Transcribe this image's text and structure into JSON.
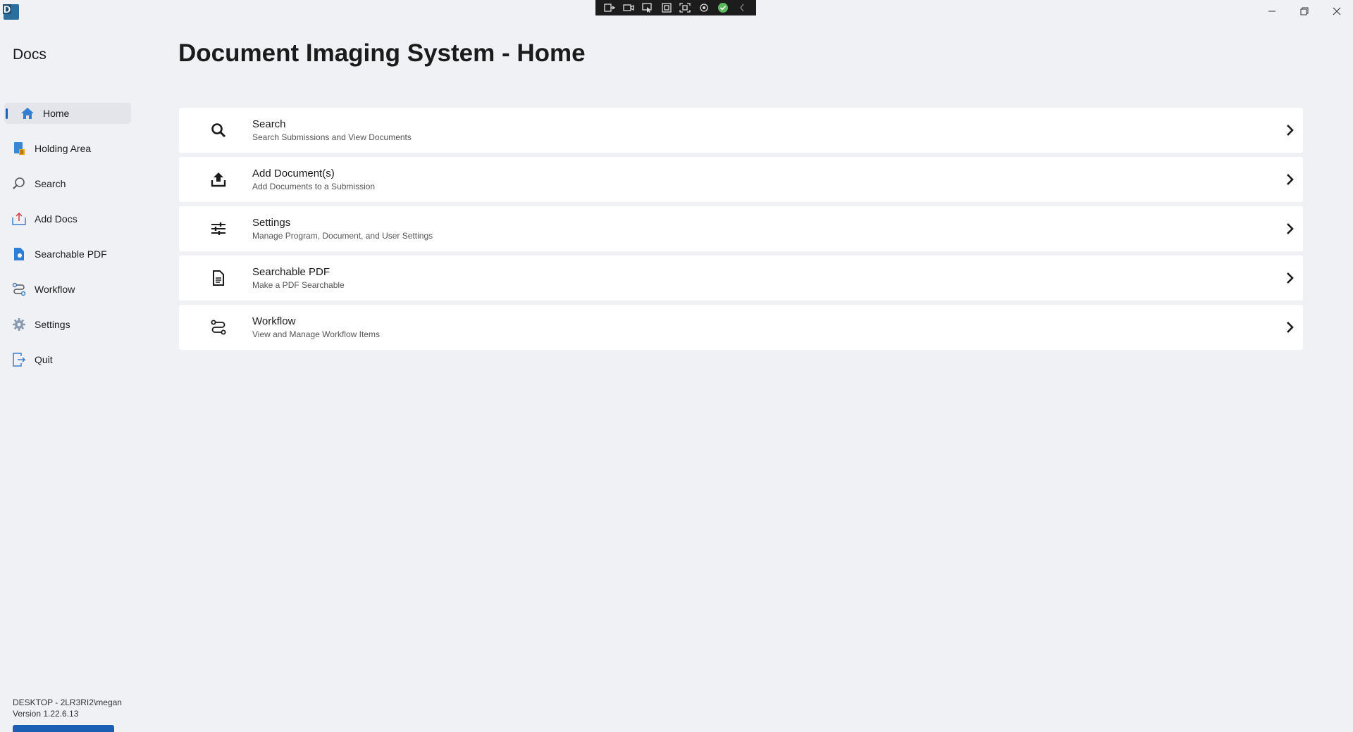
{
  "app": {
    "logo_letter": "D",
    "name": "Docs"
  },
  "titlebar": {
    "recorder_icons": [
      "steps-recorder-icon",
      "video-icon",
      "pointer-icon",
      "region-icon",
      "capture-icon",
      "settings-icon",
      "check-icon",
      "collapse-icon"
    ]
  },
  "window_controls": {
    "minimize": "─",
    "restore": "❐",
    "close": "✕"
  },
  "sidebar": {
    "items": [
      {
        "label": "Home",
        "icon": "home-icon",
        "active": true
      },
      {
        "label": "Holding Area",
        "icon": "holding-area-icon",
        "active": false
      },
      {
        "label": "Search",
        "icon": "search-icon",
        "active": false
      },
      {
        "label": "Add Docs",
        "icon": "add-docs-icon",
        "active": false
      },
      {
        "label": "Searchable PDF",
        "icon": "pdf-icon",
        "active": false
      },
      {
        "label": "Workflow",
        "icon": "workflow-icon",
        "active": false
      },
      {
        "label": "Settings",
        "icon": "gear-icon",
        "active": false
      },
      {
        "label": "Quit",
        "icon": "quit-icon",
        "active": false
      }
    ],
    "footer": {
      "user": "DESKTOP - 2LR3RI2\\megan",
      "version": "Version 1.22.6.13"
    }
  },
  "main": {
    "title": "Document Imaging System - Home",
    "cards": [
      {
        "title": "Search",
        "subtitle": "Search Submissions and View Documents",
        "icon": "magnifier-icon"
      },
      {
        "title": "Add Document(s)",
        "subtitle": "Add Documents to a Submission",
        "icon": "upload-icon"
      },
      {
        "title": "Settings",
        "subtitle": "Manage Program, Document, and User Settings",
        "icon": "sliders-icon"
      },
      {
        "title": "Searchable PDF",
        "subtitle": "Make a PDF Searchable",
        "icon": "document-icon"
      },
      {
        "title": "Workflow",
        "subtitle": "View and Manage Workflow Items",
        "icon": "route-icon"
      }
    ]
  },
  "colors": {
    "background": "#f0f1f5",
    "accent": "#1f5fbf",
    "card": "#ffffff"
  }
}
